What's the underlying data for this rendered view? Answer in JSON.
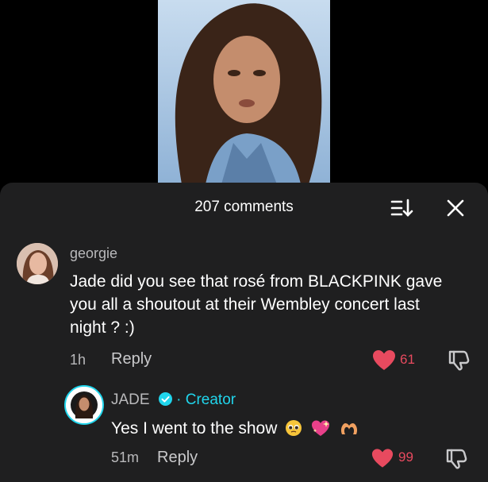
{
  "header": {
    "comment_count": "207 comments"
  },
  "comments": [
    {
      "username": "georgie",
      "text": "Jade did you see that rosé from BLACKPINK gave you all a shoutout at their Wembley concert last night ? :)",
      "time": "1h",
      "reply_label": "Reply",
      "likes": "61"
    },
    {
      "username": "JADE",
      "separator": " · ",
      "badge": "Creator",
      "text": "Yes I went to the show",
      "emojis": [
        "pleading-face-emoji",
        "sparkling-heart-emoji",
        "heart-hands-emoji"
      ],
      "time": "51m",
      "reply_label": "Reply",
      "likes": "99"
    }
  ],
  "colors": {
    "accent_cyan": "#20d5ec",
    "like_red": "#e84a5f",
    "panel_bg": "#1f1f20"
  }
}
